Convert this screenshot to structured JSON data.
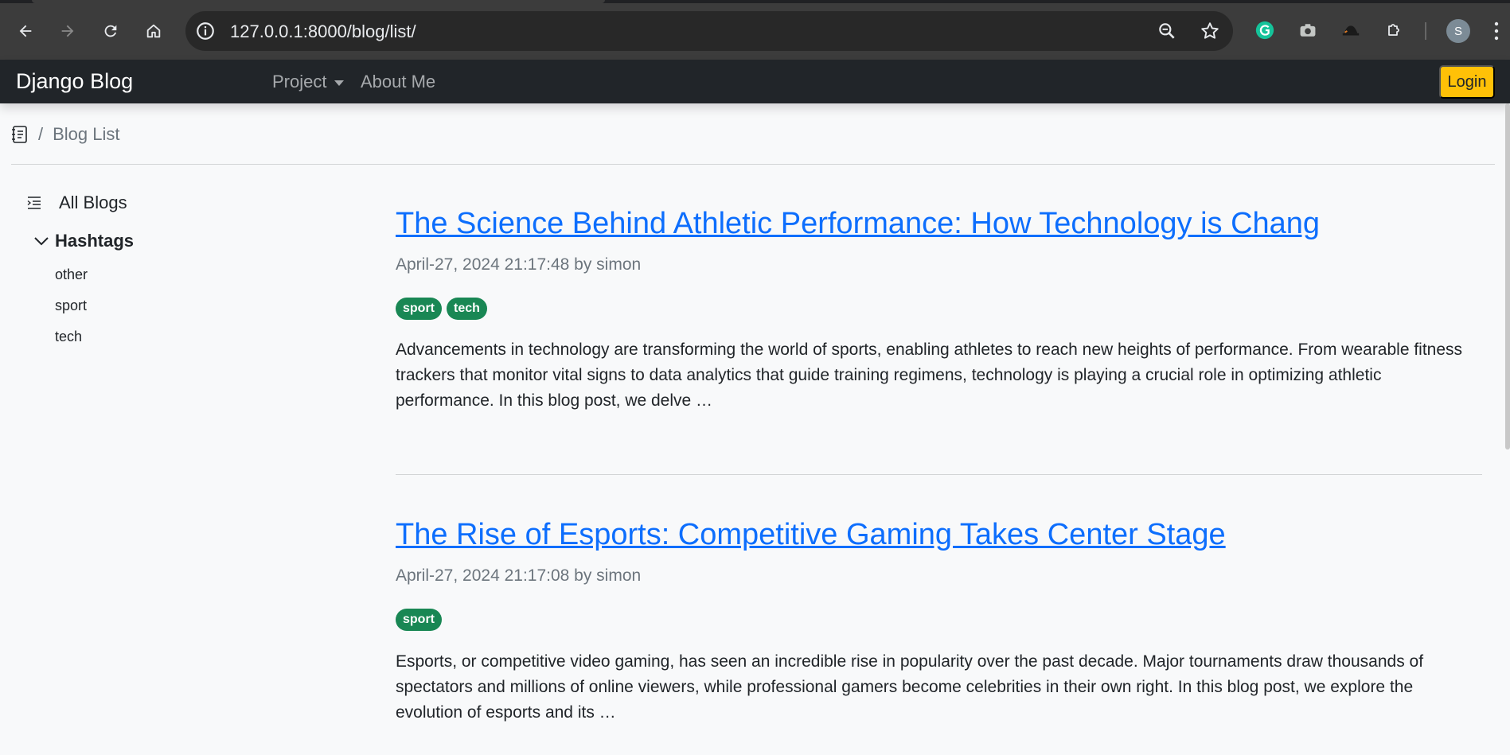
{
  "browser": {
    "url": "127.0.0.1:8000/blog/list/",
    "profile_initial": "S"
  },
  "navbar": {
    "brand": "Django Blog",
    "project_label": "Project",
    "about_label": "About Me",
    "login_label": "Login"
  },
  "breadcrumb": {
    "separator": "/",
    "current": "Blog List"
  },
  "sidebar": {
    "all_blogs": "All Blogs",
    "hashtags_title": "Hashtags",
    "tags": [
      "other",
      "sport",
      "tech"
    ]
  },
  "posts": [
    {
      "title": "The Science Behind Athletic Performance: How Technology is Chang",
      "meta": "April-27, 2024 21:17:48 by simon",
      "tags": [
        "sport",
        "tech"
      ],
      "excerpt": "Advancements in technology are transforming the world of sports, enabling athletes to reach new heights of performance. From wearable fitness trackers that monitor vital signs to data analytics that guide training regimens, technology is playing a crucial role in optimizing athletic performance. In this blog post, we delve …"
    },
    {
      "title": "The Rise of Esports: Competitive Gaming Takes Center Stage",
      "meta": "April-27, 2024 21:17:08 by simon",
      "tags": [
        "sport"
      ],
      "excerpt": "Esports, or competitive video gaming, has seen an incredible rise in popularity over the past decade. Major tournaments draw thousands of spectators and millions of online viewers, while professional gamers become celebrities in their own right. In this blog post, we explore the evolution of esports and its …"
    }
  ],
  "colors": {
    "navbar_bg": "#212529",
    "link": "#0d6efd",
    "badge": "#198754",
    "login": "#ffc107"
  }
}
